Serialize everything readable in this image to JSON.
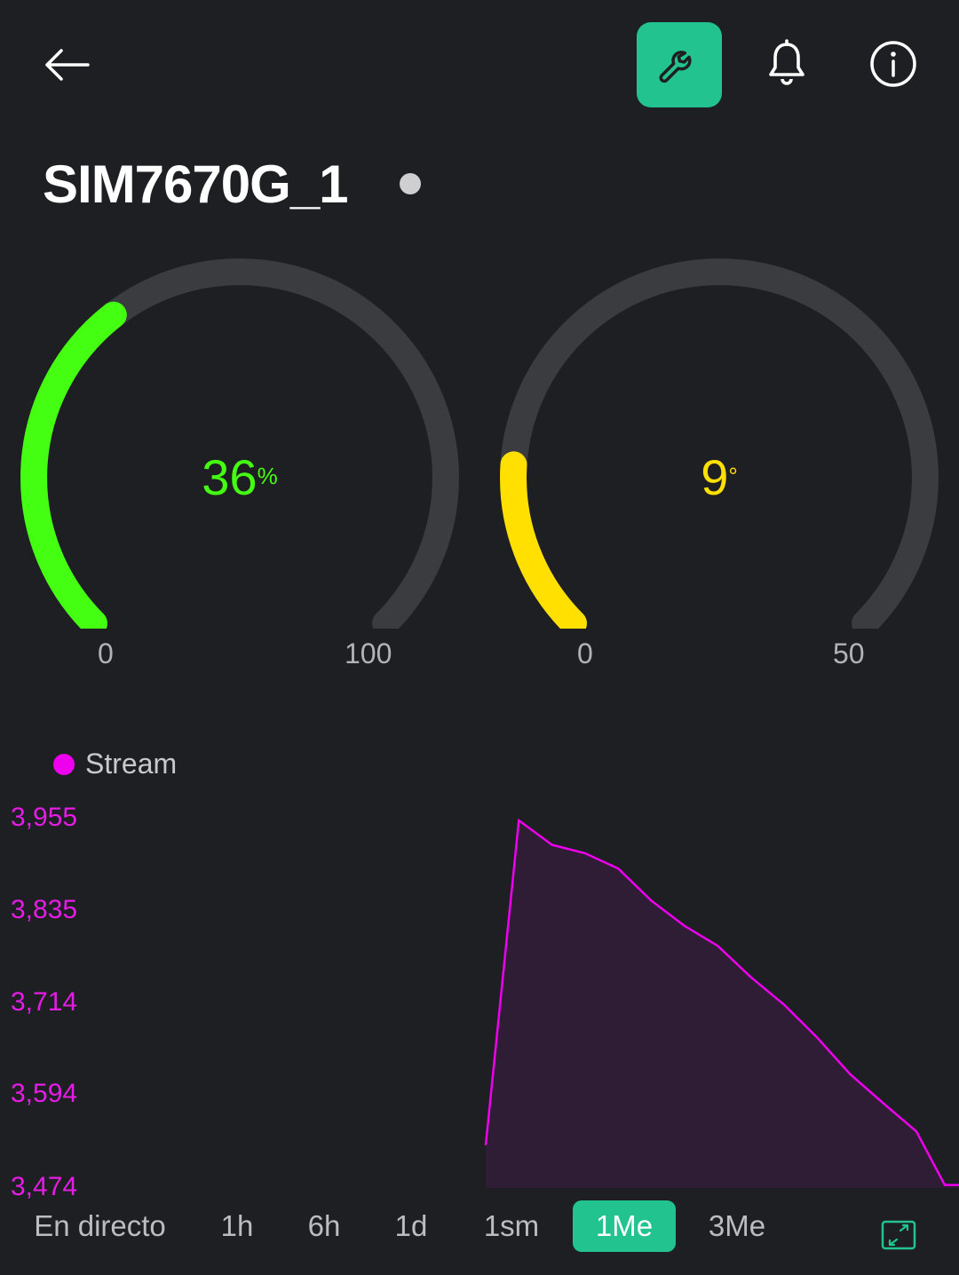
{
  "header": {
    "back_icon": "arrow-left-icon",
    "settings_icon": "wrench-icon",
    "notifications_icon": "bell-icon",
    "info_icon": "info-icon",
    "accent_color": "#22c38e"
  },
  "device": {
    "name": "SIM7670G_1",
    "status_color": "#cfcfd2"
  },
  "gauges": [
    {
      "value": "36",
      "unit": "%",
      "min": "0",
      "max": "100",
      "fraction": 0.36,
      "color": "#44ff11"
    },
    {
      "value": "9",
      "unit": "°",
      "min": "0",
      "max": "50",
      "fraction": 0.18,
      "color": "#ffe000"
    }
  ],
  "chart_legend": {
    "label": "Stream",
    "color": "#ee00ee"
  },
  "chart_data": {
    "type": "area",
    "series": [
      {
        "name": "Stream",
        "color": "#ee00ee",
        "points": [
          [
            0.0,
            3530
          ],
          [
            0.07,
            3955
          ],
          [
            0.14,
            3923
          ],
          [
            0.21,
            3912
          ],
          [
            0.28,
            3892
          ],
          [
            0.35,
            3850
          ],
          [
            0.42,
            3817
          ],
          [
            0.49,
            3791
          ],
          [
            0.56,
            3750
          ],
          [
            0.63,
            3714
          ],
          [
            0.7,
            3671
          ],
          [
            0.77,
            3623
          ],
          [
            0.84,
            3585
          ],
          [
            0.91,
            3548
          ],
          [
            0.97,
            3478
          ],
          [
            1.0,
            3478
          ]
        ]
      }
    ],
    "x_domain": [
      0,
      1
    ],
    "ylim": [
      3474,
      3955
    ],
    "y_ticks": [
      "3,955",
      "3,835",
      "3,714",
      "3,594",
      "3,474"
    ],
    "grid": false,
    "legend": "top-left"
  },
  "time_tabs": [
    {
      "label": "En directo",
      "active": false
    },
    {
      "label": "1h",
      "active": false
    },
    {
      "label": "6h",
      "active": false
    },
    {
      "label": "1d",
      "active": false
    },
    {
      "label": "1sm",
      "active": false
    },
    {
      "label": "1Me",
      "active": true
    },
    {
      "label": "3Me",
      "active": false
    }
  ],
  "expand_icon": "expand-icon"
}
